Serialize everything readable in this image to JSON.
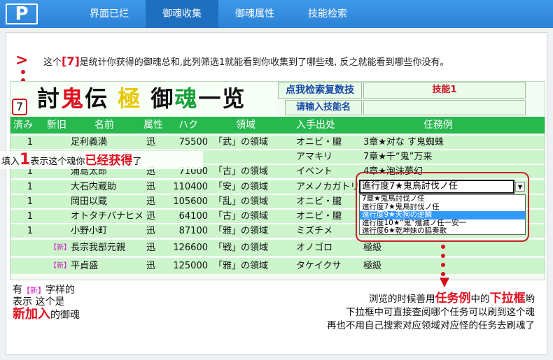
{
  "nav": {
    "logo": "P",
    "items": [
      "界面已烂",
      "御魂收集",
      "御魂属性",
      "技能检索"
    ],
    "active_index": 1
  },
  "intro": {
    "prefix": "这个",
    "highlight": "[7]",
    "suffix": "是统计你获得的御魂总和,此列筛选1就能看到你收集到了哪些魂, 反之就能看到哪些你没有。"
  },
  "sheet": {
    "count": "7",
    "title": [
      {
        "text": "討",
        "color": "#111111"
      },
      {
        "text": "鬼",
        "color": "#e01020"
      },
      {
        "text": "伝",
        "color": "#111111"
      },
      {
        "text": " 極 ",
        "color": "#e8c800"
      },
      {
        "text": "御",
        "color": "#111111"
      },
      {
        "text": "魂",
        "color": "#18a038"
      },
      {
        "text": "一览",
        "color": "#111111"
      }
    ],
    "search_button": "点我检索复数技",
    "skill_input": "请输入技能名",
    "skill_header": "技能1",
    "columns": [
      "済み",
      "新旧",
      "名前",
      "属性",
      "ハク",
      "領域",
      "入手出处",
      "任務例"
    ],
    "rows": [
      {
        "done": "1",
        "new": "",
        "name": "足利義満",
        "attr": "迅",
        "haku": "75500",
        "realm": "「武」の領域",
        "source": "オニビ・朧",
        "task": "3章★对な す鬼蜘蛛"
      },
      {
        "done": "",
        "new": "",
        "name": "",
        "attr": "",
        "haku": "",
        "realm": "",
        "source": "アマキリ",
        "task": "7章★千“鬼”万来"
      },
      {
        "done": "1",
        "new": "",
        "name": "浦島太郎",
        "attr": "迅",
        "haku": "71000",
        "realm": "「古」の領域",
        "source": "イベント",
        "task": "4章★泡沫夢幻"
      },
      {
        "done": "1",
        "new": "",
        "name": "大石内蔵助",
        "attr": "迅",
        "haku": "110400",
        "realm": "「安」の領域",
        "source": "アメノカガトリ",
        "task": ""
      },
      {
        "done": "1",
        "new": "",
        "name": "岡田以蔵",
        "attr": "迅",
        "haku": "105600",
        "realm": "「乱」の領域",
        "source": "オニビ・朧",
        "task": ""
      },
      {
        "done": "1",
        "new": "",
        "name": "オトタチバナヒメ",
        "attr": "迅",
        "haku": "64100",
        "realm": "「古」の領域",
        "source": "オニビ・朧",
        "task": ""
      },
      {
        "done": "1",
        "new": "",
        "name": "小野小町",
        "attr": "迅",
        "haku": "87100",
        "realm": "「雅」の領域",
        "source": "ミズチメ",
        "task": ""
      },
      {
        "done": "",
        "new": "【新】",
        "name": "長宗我部元親",
        "attr": "迅",
        "haku": "126600",
        "realm": "「戦」の領域",
        "source": "オノゴロ",
        "task": "極級"
      },
      {
        "done": "",
        "new": "【新】",
        "name": "平貞盛",
        "attr": "迅",
        "haku": "125000",
        "realm": "「雅」の領域",
        "source": "タケイクサ",
        "task": "極級"
      }
    ],
    "fill_note": {
      "a": "填入",
      "b": "1",
      "c": "表示这个魂你",
      "d": "已经获得",
      "e": "了"
    }
  },
  "dropdown": {
    "selected": "進行度7★鬼鳥討伐ノ任",
    "options": [
      "7章★鬼鳥討伐ノ任",
      "進行度7★鬼鳥討伐ノ任",
      "進行度9★天狗の逆鱗",
      "進行度10★“鬼”殲滅ノ任一安一",
      "進行度6★乾坤妹の脇奏歌"
    ],
    "highlighted_index": 2
  },
  "left_note": {
    "l1a": "有",
    "tag": "【新】",
    "l1b": "字样的",
    "l2": "表示 这个是",
    "l3a": "新加入",
    "l3b": "的御魂"
  },
  "right_note": {
    "l1a": "浏览的时候善用",
    "l1b": "任务例",
    "l1c": "中的",
    "l1d": "下拉框",
    "l1e": "哟",
    "l2": "下拉框中可直接查阅哪个任务可以刷到这个魂",
    "l3": "再也不用自己搜索对应领域对应怪的任务去刷魂了"
  },
  "colors": {
    "nav": "#2b82d6",
    "header": "#27b84e",
    "row": "#ccf5cc",
    "accent": "#e01020"
  }
}
